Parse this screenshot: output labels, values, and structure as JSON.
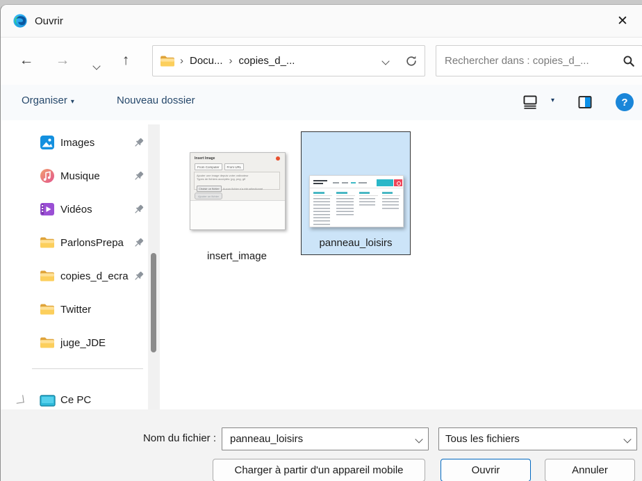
{
  "window": {
    "title": "Ouvrir",
    "close": "✕"
  },
  "nav": {
    "breadcrumb": {
      "items": [
        "Docu...",
        "copies_d_..."
      ],
      "separator": "›"
    },
    "search_placeholder": "Rechercher dans : copies_d_..."
  },
  "command_bar": {
    "organiser": "Organiser",
    "organiser_caret": "▾",
    "new_folder": "Nouveau dossier",
    "view_caret": "▾",
    "help": "?"
  },
  "sidebar": {
    "items": [
      {
        "label": "Images",
        "icon": "pictures",
        "pinned": true
      },
      {
        "label": "Musique",
        "icon": "music",
        "pinned": true
      },
      {
        "label": "Vidéos",
        "icon": "videos",
        "pinned": true
      },
      {
        "label": "ParlonsPrepa",
        "icon": "folder",
        "pinned": true
      },
      {
        "label": "copies_d_ecra",
        "icon": "folder",
        "pinned": true
      },
      {
        "label": "Twitter",
        "icon": "folder",
        "pinned": false
      },
      {
        "label": "juge_JDE",
        "icon": "folder",
        "pinned": false
      }
    ],
    "this_pc": "Ce PC"
  },
  "files": {
    "items": [
      {
        "name": "insert_image",
        "selected": false
      },
      {
        "name": "panneau_loisirs",
        "selected": true
      }
    ],
    "insert_image_preview": {
      "title": "Insert Image",
      "tab_computer": "From Computer",
      "tab_url": "From URL",
      "line1": "Ajouter une image depuis votre ordinateur",
      "line2": "Types de fichiers acceptés: jpg, png, gif",
      "choose_button": "Choisir un fichier",
      "no_file": "Aucun fichier n'a été sélectionné",
      "add_button": "Ajouter un fichier"
    }
  },
  "footer": {
    "filename_label": "Nom du fichier :",
    "filename_value": "panneau_loisirs",
    "filetype_value": "Tous les fichiers",
    "mobile_button": "Charger à partir d'un appareil mobile",
    "open_button": "Ouvrir",
    "cancel_button": "Annuler"
  },
  "colors": {
    "accent": "#0067c0",
    "selection_fill": "#cce4f8",
    "command_text": "#26486b",
    "help_blue": "#1a86d9"
  }
}
